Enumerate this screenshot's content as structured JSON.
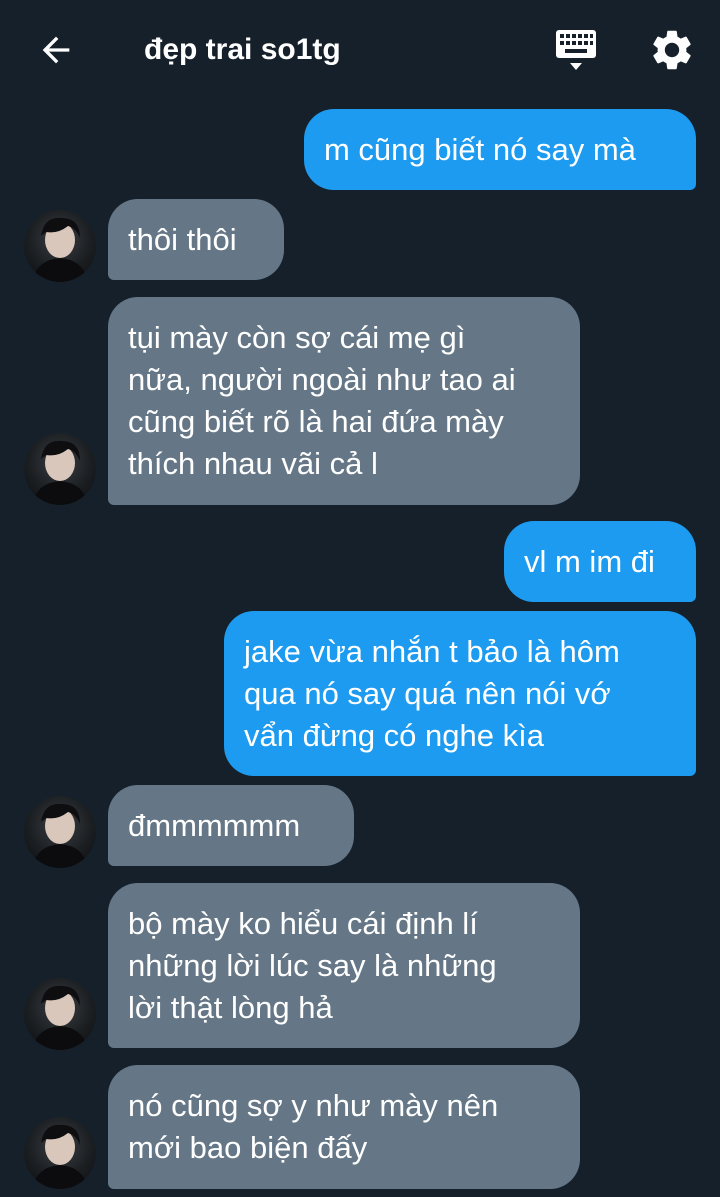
{
  "header": {
    "title": "đẹp trai so1tg"
  },
  "messages": [
    {
      "from": "me",
      "text": "m cũng biết nó say mà"
    },
    {
      "from": "them",
      "text": "thôi thôi"
    },
    {
      "from": "them",
      "text": "tụi mày còn sợ cái mẹ gì\nnữa, người ngoài như tao ai\ncũng biết rõ là hai đứa mày\nthích nhau vãi cả l"
    },
    {
      "from": "me",
      "text": "vl m im đi"
    },
    {
      "from": "me",
      "text": "jake vừa nhắn t bảo là hôm\nqua nó say quá nên nói vớ\nvẩn đừng có nghe kìa"
    },
    {
      "from": "them",
      "text": "đmmmmmm"
    },
    {
      "from": "them",
      "text": "bộ mày ko hiểu cái định lí\nnhững lời lúc say là những\nlời thật lòng hả"
    },
    {
      "from": "them",
      "text": "nó cũng sợ y như mày nên\nmới bao biện đấy"
    }
  ],
  "colors": {
    "background": "#15202b",
    "outgoing_bubble": "#1d9bf0",
    "incoming_bubble": "#657786"
  },
  "icons": [
    "arrow-back-icon",
    "keyboard-icon",
    "gear-icon"
  ]
}
